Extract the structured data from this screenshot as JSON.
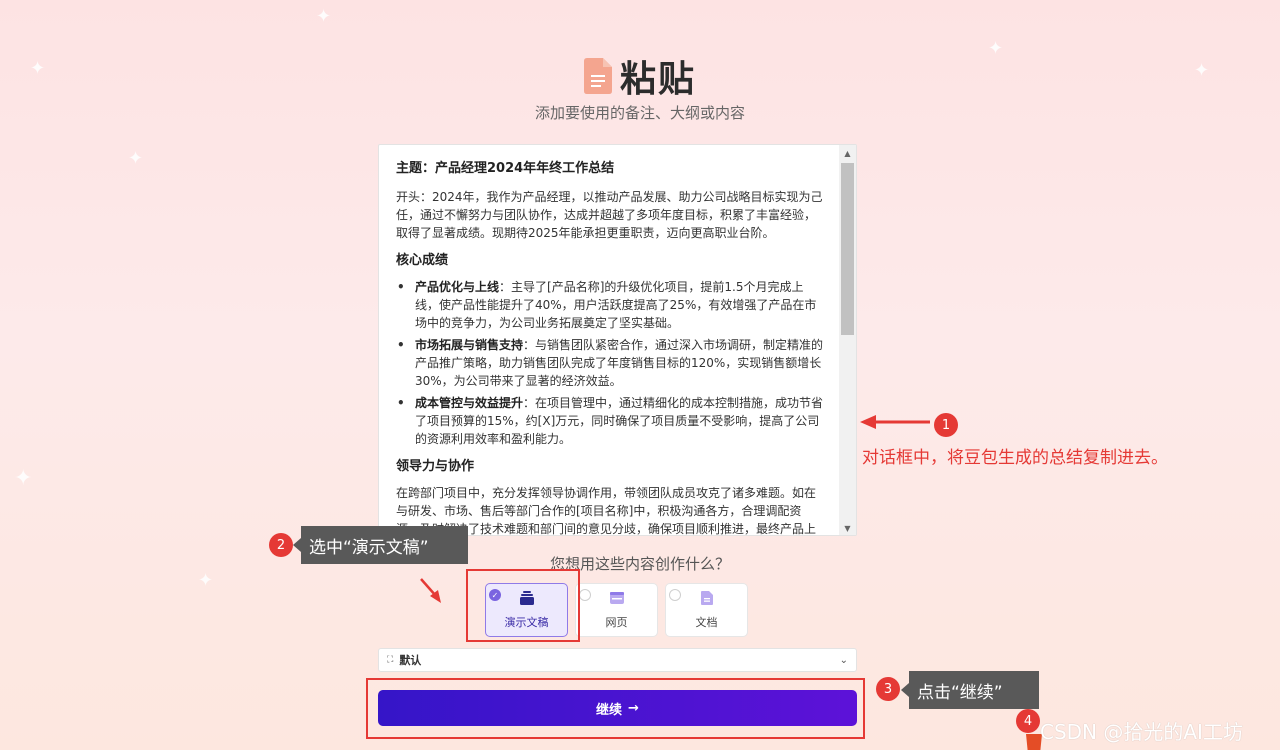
{
  "header": {
    "title": "粘贴",
    "subtitle": "添加要使用的备注、大纲或内容"
  },
  "editor": {
    "heading": "主题：产品经理2024年年终工作总结",
    "intro": "开头：2024年，我作为产品经理，以推动产品发展、助力公司战略目标实现为己任，通过不懈努力与团队协作，达成并超越了多项年度目标，积累了丰富经验，取得了显著成绩。现期待2025年能承担更重职责，迈向更高职业台阶。",
    "section1_title": "核心成绩",
    "achievements": [
      {
        "title": "产品优化与上线",
        "text": "：主导了[产品名称]的升级优化项目，提前1.5个月完成上线，使产品性能提升了40%，用户活跃度提高了25%，有效增强了产品在市场中的竞争力，为公司业务拓展奠定了坚实基础。"
      },
      {
        "title": "市场拓展与销售支持",
        "text": "：与销售团队紧密合作，通过深入市场调研，制定精准的产品推广策略，助力销售团队完成了年度销售目标的120%，实现销售额增长30%，为公司带来了显著的经济效益。"
      },
      {
        "title": "成本管控与效益提升",
        "text": "：在项目管理中，通过精细化的成本控制措施，成功节省了项目预算的15%，约[X]万元，同时确保了项目质量不受影响，提高了公司的资源利用效率和盈利能力。"
      }
    ],
    "section2_title": "领导力与协作",
    "section2_text": "在跨部门项目中，充分发挥领导协调作用，带领团队成员攻克了诸多难题。如在与研发、市场、售后等部门合作的[项目名称]中，积极沟通各方，合理调配资源，及时解决了技术难题和部门间的意见分歧，确保项目顺利推进，最终产品上"
  },
  "question": "您想用这些内容创作什么？",
  "options": [
    {
      "label": "演示文稿",
      "icon": "presentation-icon",
      "selected": true
    },
    {
      "label": "网页",
      "icon": "webpage-icon",
      "selected": false
    },
    {
      "label": "文档",
      "icon": "document-icon",
      "selected": false
    }
  ],
  "template_select": {
    "value": "默认"
  },
  "continue_button": {
    "label": "继续",
    "arrow": "→"
  },
  "annotations": {
    "badge1": "1",
    "badge2": "2",
    "badge3": "3",
    "badge4": "4",
    "note1": "对话框中，将豆包生成的总结复制进去。",
    "tip2": "选中“演示文稿”",
    "tip3": "点击“继续”"
  },
  "watermark": "CSDN @拾光的AI工坊",
  "colors": {
    "accent": "#5d12d8",
    "annotation_red": "#e53935",
    "selected_bg": "#ede9fd"
  }
}
